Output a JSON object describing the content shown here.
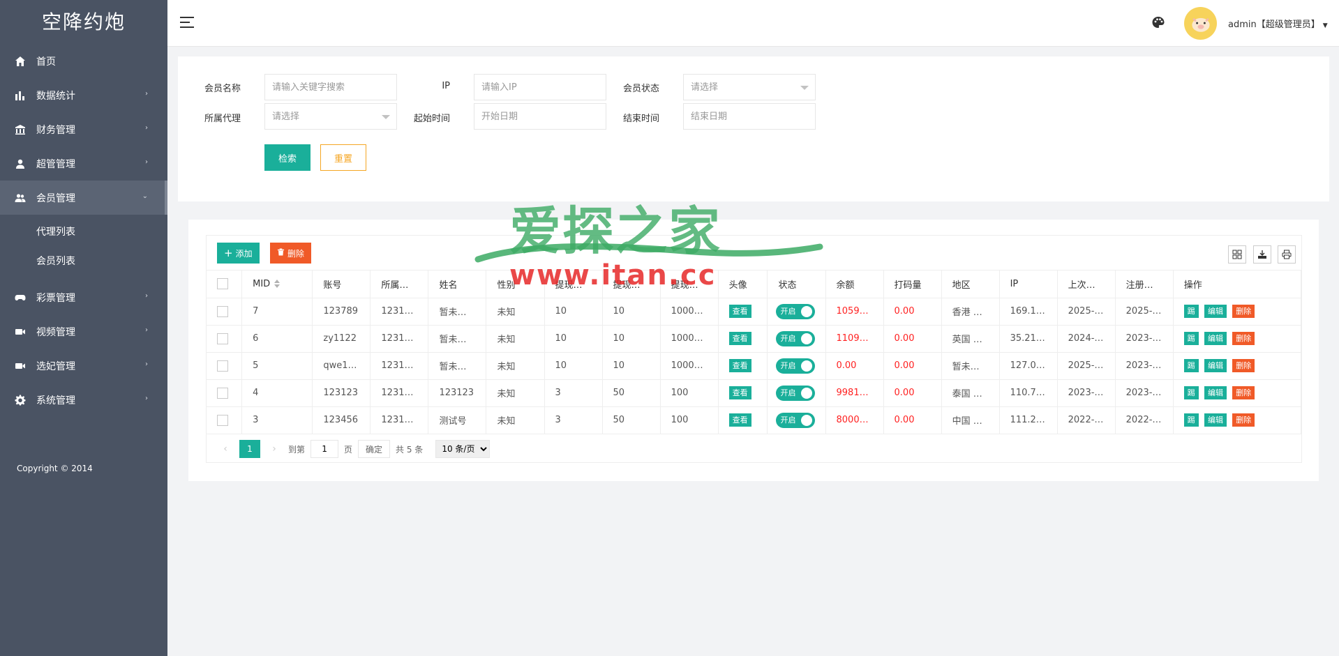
{
  "app": {
    "logo_text": "空降约炮"
  },
  "sidebar": {
    "items": [
      {
        "label": "首页",
        "icon": "home-icon"
      },
      {
        "label": "数据统计",
        "icon": "bar-chart-icon"
      },
      {
        "label": "财务管理",
        "icon": "bank-icon"
      },
      {
        "label": "超管管理",
        "icon": "user-icon"
      },
      {
        "label": "会员管理",
        "icon": "users-icon",
        "active": true
      },
      {
        "label": "彩票管理",
        "icon": "gamepad-icon"
      },
      {
        "label": "视频管理",
        "icon": "video-icon"
      },
      {
        "label": "选妃管理",
        "icon": "video-icon"
      },
      {
        "label": "系统管理",
        "icon": "gear-icon"
      }
    ],
    "submenu": [
      {
        "label": "代理列表"
      },
      {
        "label": "会员列表"
      }
    ],
    "copyright": "Copyright © 2014"
  },
  "header": {
    "user": "admin【超级管理员】"
  },
  "search": {
    "member_name": {
      "label": "会员名称",
      "placeholder": "请输入关键字搜索"
    },
    "ip": {
      "label": "IP",
      "placeholder": "请输入IP"
    },
    "member_status": {
      "label": "会员状态",
      "placeholder": "请选择"
    },
    "agent": {
      "label": "所属代理",
      "placeholder": "请选择"
    },
    "start_time": {
      "label": "起始时间",
      "placeholder": "开始日期"
    },
    "end_time": {
      "label": "结束时间",
      "placeholder": "结束日期"
    },
    "search_btn": "检索",
    "reset_btn": "重置"
  },
  "toolbar": {
    "add_label": "添加",
    "delete_label": "删除"
  },
  "table": {
    "headers": [
      "MID",
      "账号",
      "所属…",
      "姓名",
      "性别",
      "提现…",
      "提现…",
      "提现…",
      "头像",
      "状态",
      "余额",
      "打码量",
      "地区",
      "IP",
      "上次…",
      "注册…",
      "操作"
    ],
    "view_btn": "查看",
    "switch_label": "开启",
    "kick_btn": "踢",
    "edit_btn": "编辑",
    "delete_btn": "删除",
    "rows": [
      {
        "mid": "7",
        "account": "123789",
        "agent": "1231…",
        "name": "暂未…",
        "gender": "未知",
        "w1": "10",
        "w2": "10",
        "w3": "1000…",
        "balance": "1059…",
        "bet": "0.00",
        "region": "香港 …",
        "ip": "169.1…",
        "last": "2025-…",
        "reg": "2025-…"
      },
      {
        "mid": "6",
        "account": "zy1122",
        "agent": "1231…",
        "name": "暂未…",
        "gender": "未知",
        "w1": "10",
        "w2": "10",
        "w3": "1000…",
        "balance": "1109…",
        "bet": "0.00",
        "region": "英国 …",
        "ip": "35.21…",
        "last": "2024-…",
        "reg": "2023-…"
      },
      {
        "mid": "5",
        "account": "qwe1…",
        "agent": "1231…",
        "name": "暂未…",
        "gender": "未知",
        "w1": "10",
        "w2": "10",
        "w3": "1000…",
        "balance": "0.00",
        "bet": "0.00",
        "region": "暂未…",
        "ip": "127.0…",
        "last": "2025-…",
        "reg": "2023-…"
      },
      {
        "mid": "4",
        "account": "123123",
        "agent": "1231…",
        "name": "123123",
        "gender": "未知",
        "w1": "3",
        "w2": "50",
        "w3": "100",
        "balance": "9981…",
        "bet": "0.00",
        "region": "泰国 …",
        "ip": "110.7…",
        "last": "2023-…",
        "reg": "2023-…"
      },
      {
        "mid": "3",
        "account": "123456",
        "agent": "1231…",
        "name": "测试号",
        "gender": "未知",
        "w1": "3",
        "w2": "50",
        "w3": "100",
        "balance": "8000…",
        "bet": "0.00",
        "region": "中国 …",
        "ip": "111.2…",
        "last": "2022-…",
        "reg": "2022-…"
      }
    ]
  },
  "pager": {
    "current": "1",
    "goto_label": "到第",
    "page_input": "1",
    "page_unit": "页",
    "confirm": "确定",
    "total": "共 5 条",
    "page_size": "10 条/页"
  },
  "watermark": {
    "title": "爱探之家",
    "url": "www.itan.cc"
  },
  "colors": {
    "sidebar": "#4a5363",
    "primary": "#1aaf9a",
    "danger": "#f05a28",
    "warn": "#f5a623",
    "balance": "#ff2020"
  }
}
